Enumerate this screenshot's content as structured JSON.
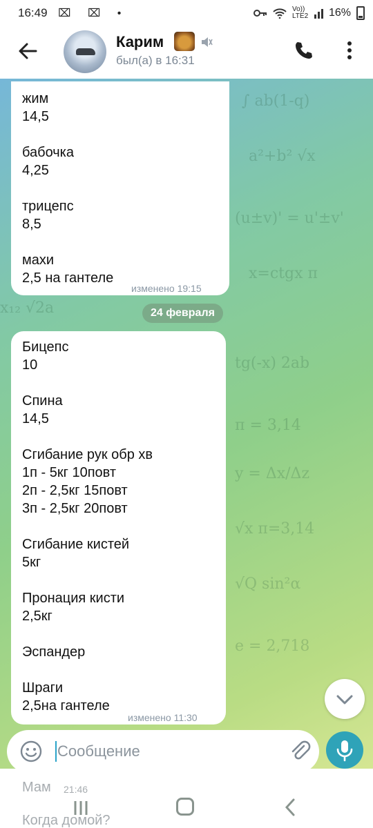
{
  "status_bar": {
    "time": "16:49",
    "left_icons": "⌧ ⌧ •",
    "network": "Vo)) LTE2",
    "battery": "16%"
  },
  "header": {
    "contact_name": "Карим",
    "last_seen": "был(а) в 16:31"
  },
  "messages": [
    {
      "lines": [
        "жим",
        "14,5",
        "",
        "бабочка",
        "4,25",
        "",
        "трицепс",
        "8,5",
        "",
        "махи",
        "2,5 на гантеле"
      ],
      "status": "изменено 19:15"
    },
    {
      "lines": [
        "Бицепс",
        "10",
        "",
        "Спина",
        "14,5",
        "",
        "Сгибание рук обр хв",
        "1п - 5кг 10повт",
        "2п - 2,5кг 15повт",
        "3п - 2,5кг 20повт",
        "",
        "Сгибание кистей",
        "5кг",
        "",
        "Пронация кисти",
        "2,5кг",
        "",
        "Эспандер",
        "",
        "Шраги",
        "2,5на гантеле"
      ],
      "status": "изменено 11:30"
    }
  ],
  "date_separator": "24 февраля",
  "composer": {
    "placeholder": "Сообщение"
  },
  "underlay": {
    "message1": "Мам",
    "message1_time": "21:46",
    "message2": "Когда домой?"
  },
  "icons": {
    "back": "arrow-left",
    "call": "phone",
    "menu": "more-vertical",
    "mute": "speaker-mute",
    "emoji": "smile",
    "attach": "paperclip",
    "mic": "microphone",
    "scroll_down": "chevron-down"
  },
  "colors": {
    "accent": "#2fa3b8",
    "status_text": "#8a97a4"
  }
}
